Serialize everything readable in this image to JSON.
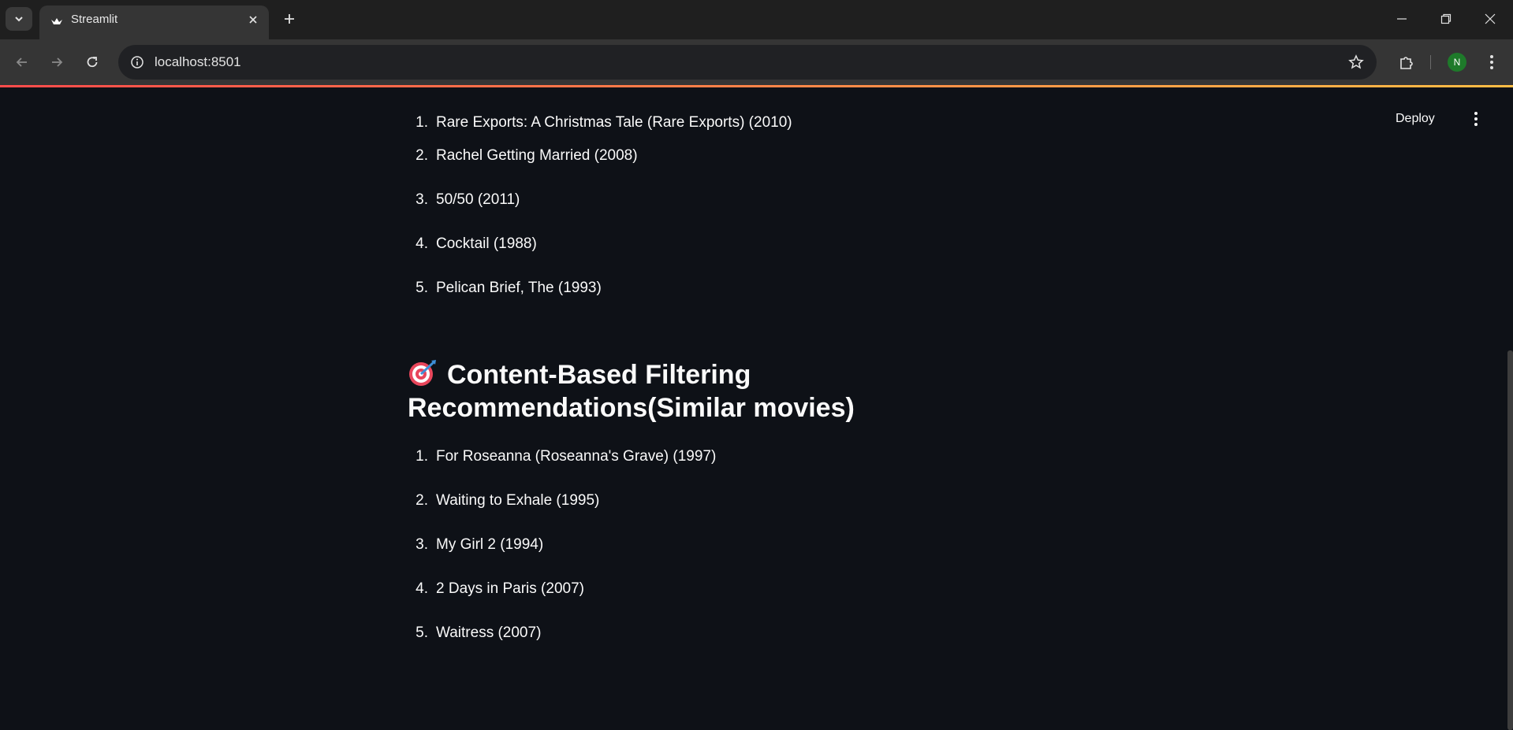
{
  "browser": {
    "tab_title": "Streamlit",
    "url": "localhost:8501",
    "profile_initial": "N"
  },
  "app": {
    "deploy_label": "Deploy",
    "first_list": [
      {
        "num": "1.",
        "title": "Rare Exports: A Christmas Tale (Rare Exports) (2010)"
      },
      {
        "num": "2.",
        "title": "Rachel Getting Married (2008)"
      },
      {
        "num": "3.",
        "title": "50/50 (2011)"
      },
      {
        "num": "4.",
        "title": "Cocktail (1988)"
      },
      {
        "num": "5.",
        "title": "Pelican Brief, The (1993)"
      }
    ],
    "content_heading": "Content-Based Filtering Recommendations(Similar movies)",
    "content_list": [
      {
        "num": "1.",
        "title": "For Roseanna (Roseanna's Grave) (1997)"
      },
      {
        "num": "2.",
        "title": "Waiting to Exhale (1995)"
      },
      {
        "num": "3.",
        "title": "My Girl 2 (1994)"
      },
      {
        "num": "4.",
        "title": "2 Days in Paris (2007)"
      },
      {
        "num": "5.",
        "title": "Waitress (2007)"
      }
    ]
  },
  "colors": {
    "app_background": "#0e1117",
    "decoration_start": "#ff4b4b",
    "decoration_end": "#ffbd45",
    "avatar": "#1e7a2a"
  }
}
